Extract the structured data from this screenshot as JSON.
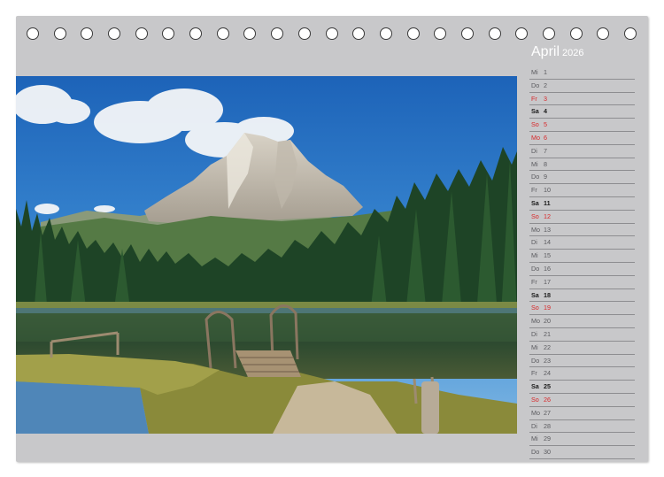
{
  "calendar": {
    "month": "April",
    "year": "2026",
    "binding_holes": 23,
    "colors": {
      "background": "#c8c8ca",
      "sunday": "#d8282a",
      "saturday": "#1a1a1a",
      "weekday": "#5a5a5e"
    },
    "days": [
      {
        "name": "Mi",
        "num": "1",
        "type": "weekday"
      },
      {
        "name": "Do",
        "num": "2",
        "type": "weekday"
      },
      {
        "name": "Fr",
        "num": "3",
        "type": "holiday"
      },
      {
        "name": "Sa",
        "num": "4",
        "type": "sat"
      },
      {
        "name": "So",
        "num": "5",
        "type": "sun"
      },
      {
        "name": "Mo",
        "num": "6",
        "type": "holiday"
      },
      {
        "name": "Di",
        "num": "7",
        "type": "weekday"
      },
      {
        "name": "Mi",
        "num": "8",
        "type": "weekday"
      },
      {
        "name": "Do",
        "num": "9",
        "type": "weekday"
      },
      {
        "name": "Fr",
        "num": "10",
        "type": "weekday"
      },
      {
        "name": "Sa",
        "num": "11",
        "type": "sat"
      },
      {
        "name": "So",
        "num": "12",
        "type": "sun"
      },
      {
        "name": "Mo",
        "num": "13",
        "type": "weekday"
      },
      {
        "name": "Di",
        "num": "14",
        "type": "weekday"
      },
      {
        "name": "Mi",
        "num": "15",
        "type": "weekday"
      },
      {
        "name": "Do",
        "num": "16",
        "type": "weekday"
      },
      {
        "name": "Fr",
        "num": "17",
        "type": "weekday"
      },
      {
        "name": "Sa",
        "num": "18",
        "type": "sat"
      },
      {
        "name": "So",
        "num": "19",
        "type": "sun"
      },
      {
        "name": "Mo",
        "num": "20",
        "type": "weekday"
      },
      {
        "name": "Di",
        "num": "21",
        "type": "weekday"
      },
      {
        "name": "Mi",
        "num": "22",
        "type": "weekday"
      },
      {
        "name": "Do",
        "num": "23",
        "type": "weekday"
      },
      {
        "name": "Fr",
        "num": "24",
        "type": "weekday"
      },
      {
        "name": "Sa",
        "num": "25",
        "type": "sat"
      },
      {
        "name": "So",
        "num": "26",
        "type": "sun"
      },
      {
        "name": "Mo",
        "num": "27",
        "type": "weekday"
      },
      {
        "name": "Di",
        "num": "28",
        "type": "weekday"
      },
      {
        "name": "Mi",
        "num": "29",
        "type": "weekday"
      },
      {
        "name": "Do",
        "num": "30",
        "type": "weekday"
      }
    ]
  }
}
